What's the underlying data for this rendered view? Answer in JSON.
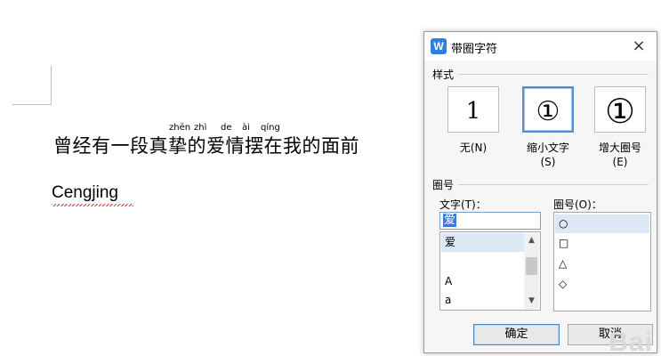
{
  "document": {
    "line1": "曾经有一段真挚的爱情摆在我的面前",
    "pinyin": [
      "zhēn",
      "zhì",
      "de",
      "ài",
      "qíng"
    ],
    "line2": "Cengjing"
  },
  "dialog": {
    "title": "带圈字符",
    "app_icon": "W",
    "close_icon": "×",
    "style_group_label": "样式",
    "styles": [
      {
        "caption": "无(N)",
        "glyph": "1"
      },
      {
        "caption": "缩小文字\n(S)",
        "glyph": "①"
      },
      {
        "caption": "增大圈号\n(E)",
        "glyph": "①"
      }
    ],
    "selected_style": 1,
    "enclosure_group_label": "圈号",
    "text_label": "文字(T)：",
    "text_value": "爱",
    "text_list": [
      "爱",
      "",
      "A",
      "a"
    ],
    "enclosure_label": "圈号(O)：",
    "enclosure_list": [
      "○",
      "□",
      "△",
      "◇"
    ],
    "ok_label": "确定",
    "cancel_label": "取消"
  },
  "colors": {
    "accent": "#5b8fc9",
    "selection": "#3b7bd4",
    "highlight": "#dde8f6",
    "spellcheck": "#e53935"
  },
  "watermark": "Bai"
}
